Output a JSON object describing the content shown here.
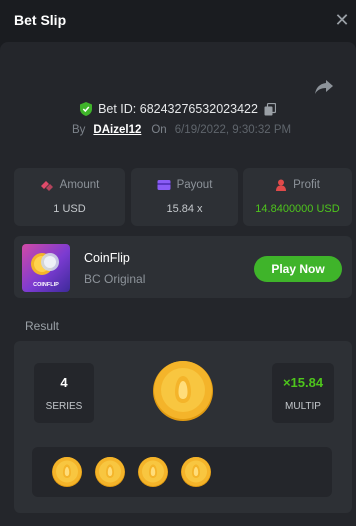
{
  "header": {
    "title": "Bet Slip",
    "close_icon": "close-icon"
  },
  "bet": {
    "id_text": "Bet ID: 68243276532023422",
    "by_label": "By",
    "user": "DAizel12",
    "on_label": "On",
    "date": "6/19/2022, 9:30:32 PM"
  },
  "stats": [
    {
      "label": "Amount",
      "value": "1 USD",
      "icon": "coins-icon"
    },
    {
      "label": "Payout",
      "value": "15.84 x",
      "icon": "wallet-icon"
    },
    {
      "label": "Profit",
      "value": "14.8400000 USD",
      "icon": "profit-icon"
    }
  ],
  "game": {
    "name": "CoinFlip",
    "subtitle": "BC Original",
    "thumb_title": "COINFLIP",
    "play_label": "Play Now"
  },
  "result": {
    "section_label": "Result",
    "series_value": "4",
    "series_label": "SERIES",
    "multip_value": "×15.84",
    "multip_label": "MULTIP",
    "coin_count": 4
  },
  "colors": {
    "accent_green": "#3fb42a",
    "profit_green": "#4ec51c",
    "panel": "#24262b",
    "card": "#2d3035",
    "coin": "#f4b42a"
  }
}
